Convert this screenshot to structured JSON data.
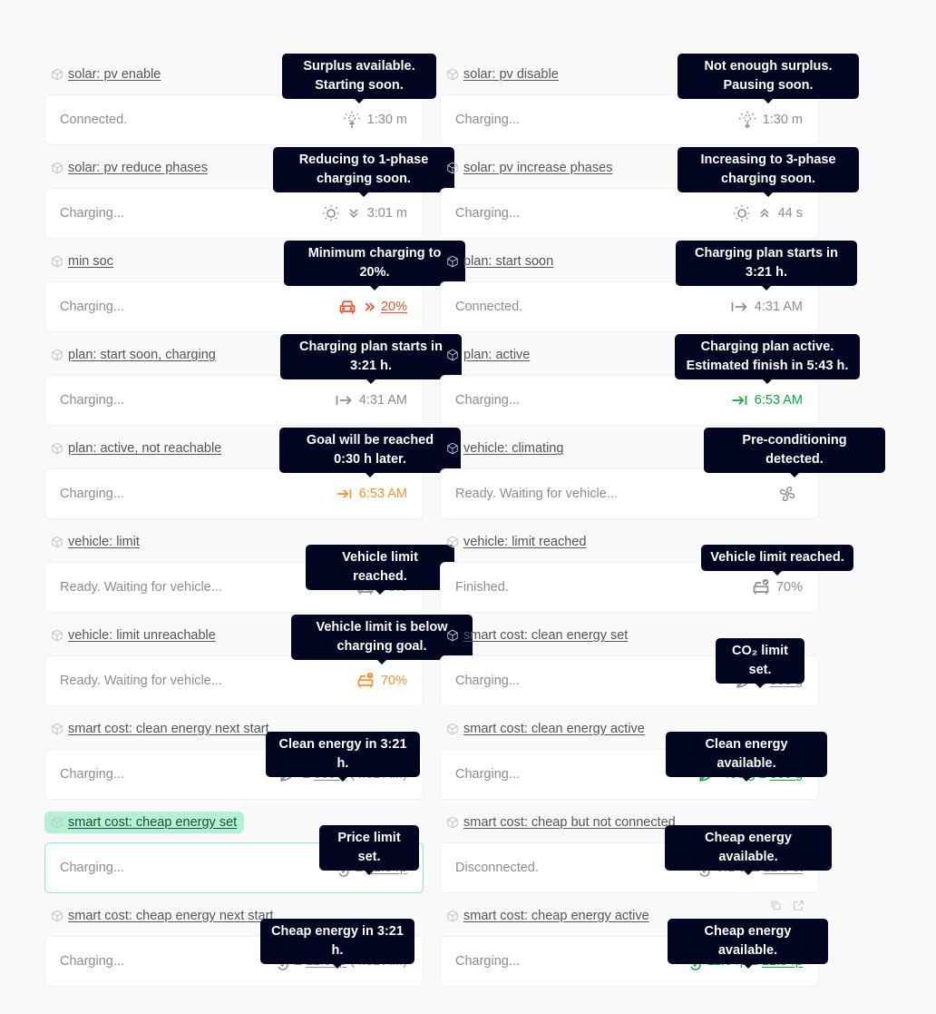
{
  "stories": [
    {
      "title": "solar: pv enable",
      "status": "Connected.",
      "icon": "sun-up-icon",
      "color": "gray",
      "value": "1:30 m",
      "tooltip": [
        "Surplus available.",
        "Starting soon."
      ]
    },
    {
      "title": "solar: pv disable",
      "status": "Charging...",
      "icon": "sun-down-icon",
      "color": "gray",
      "value": "1:30 m",
      "tooltip": [
        "Not enough surplus.",
        "Pausing soon."
      ]
    },
    {
      "title": "solar: pv reduce phases",
      "status": "Charging...",
      "icon": "sun-icon",
      "icon2": "chevrons-down-icon",
      "color": "gray",
      "value": "3:01 m",
      "tooltip": [
        "Reducing to 1-phase",
        "charging soon."
      ]
    },
    {
      "title": "solar: pv increase phases",
      "status": "Charging...",
      "icon": "sun-icon",
      "icon2": "chevrons-up-icon",
      "color": "gray",
      "value": "44 s",
      "tooltip": [
        "Increasing to 3-phase",
        "charging soon."
      ]
    },
    {
      "title": "min soc",
      "status": "Charging...",
      "icon": "car-icon",
      "icon2": "chevrons-right-icon",
      "color": "red",
      "value_link": "20%",
      "tooltip": [
        "Minimum charging to",
        "20%."
      ]
    },
    {
      "title": "plan: start soon",
      "status": "Connected.",
      "icon": "arrow-from-bar-icon",
      "color": "gray",
      "value": "4:31 AM",
      "tooltip": [
        "Charging plan starts in",
        "3:21 h."
      ]
    },
    {
      "title": "plan: start soon, charging",
      "status": "Charging...",
      "icon": "arrow-from-bar-icon",
      "color": "gray",
      "value": "4:31 AM",
      "tooltip": [
        "Charging plan starts in",
        "3:21 h."
      ]
    },
    {
      "title": "plan: active",
      "status": "Charging...",
      "icon": "arrow-to-bar-icon",
      "color": "green",
      "value": "6:53 AM",
      "tooltip": [
        "Charging plan active.",
        "Estimated finish in 5:43 h."
      ]
    },
    {
      "title": "plan: active, not reachable",
      "status": "Charging...",
      "icon": "arrow-to-bar-icon",
      "color": "orange",
      "value": "6:53 AM",
      "tooltip": [
        "Goal will be reached",
        "0:30 h later."
      ]
    },
    {
      "title": "vehicle: climating",
      "status": "Ready. Waiting for vehicle...",
      "icon": "fan-icon",
      "color": "gray",
      "value": "",
      "tooltip": [
        "Pre-conditioning",
        "detected."
      ]
    },
    {
      "title": "vehicle: limit",
      "status": "Ready. Waiting for vehicle...",
      "icon": "car-icon",
      "color": "gray",
      "value": "70%",
      "tooltip": [
        "Vehicle limit reached."
      ]
    },
    {
      "title": "vehicle: limit reached",
      "status": "Finished.",
      "icon": "car-check-icon",
      "color": "gray",
      "value": "70%",
      "tooltip": [
        "Vehicle limit reached."
      ]
    },
    {
      "title": "vehicle: limit unreachable",
      "status": "Ready. Waiting for vehicle...",
      "icon": "car-warning-icon",
      "color": "orange",
      "value": "70%",
      "tooltip": [
        "Vehicle limit is below",
        "charging goal."
      ]
    },
    {
      "title": "smart cost: clean energy set",
      "status": "Charging...",
      "icon": "leaf-icon",
      "color": "gray",
      "value_prefix": "≤ ",
      "value_link": "500 g",
      "tooltip": [
        "CO₂ limit set."
      ]
    },
    {
      "title": "smart cost: clean energy next start",
      "status": "Charging...",
      "icon": "leaf-icon",
      "color": "gray",
      "value_prefix": "≤ ",
      "value_link": "500 g",
      "value_suffix": " (4:31 AM)",
      "tooltip": [
        "Clean energy in 3:21 h."
      ]
    },
    {
      "title": "smart cost: clean energy active",
      "status": "Charging...",
      "icon": "leaf-icon",
      "color": "green",
      "value_prefix": "400 g ≤ ",
      "value_link": "500 g",
      "tooltip": [
        "Clean energy available."
      ]
    },
    {
      "title": "smart cost: cheap energy set",
      "status": "Charging...",
      "icon": "coins-icon",
      "color": "gray",
      "value_prefix": "≤ ",
      "value_link": "12.0 rp",
      "tooltip": [
        "Price limit set."
      ],
      "selected": true
    },
    {
      "title": "smart cost: cheap but not connected",
      "status": "Disconnected.",
      "icon": "coins-icon",
      "color": "gray",
      "value_prefix": "9.1 ct ≤ ",
      "value_link": "12.0 ct",
      "tooltip": [
        "Cheap energy available."
      ]
    },
    {
      "title": "smart cost: cheap energy next start",
      "status": "Charging...",
      "icon": "coins-icon",
      "color": "gray",
      "value_prefix": "≤ ",
      "value_link": "12.0 rp",
      "value_suffix": " (4:31 AM)",
      "tooltip": [
        "Cheap energy in 3:21 h."
      ]
    },
    {
      "title": "smart cost: cheap energy active",
      "status": "Charging...",
      "icon": "coins-icon",
      "color": "green",
      "value_prefix": "11.0 rp ≤ ",
      "value_link": "12.0 rp",
      "tooltip": [
        "Cheap energy available."
      ],
      "tools": [
        "copy-icon",
        "external-link-icon"
      ]
    }
  ]
}
